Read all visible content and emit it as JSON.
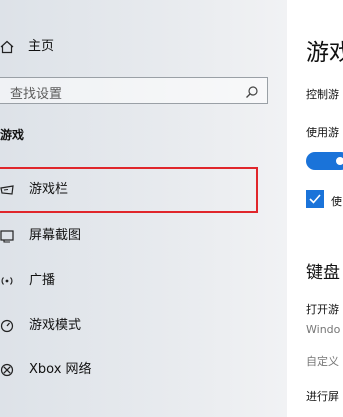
{
  "sidebar": {
    "home_label": "主页",
    "search_placeholder": "查找设置",
    "section_title": "游戏",
    "items": [
      {
        "label": "游戏栏",
        "icon": "game-bar-icon"
      },
      {
        "label": "屏幕截图",
        "icon": "capture-icon"
      },
      {
        "label": "广播",
        "icon": "broadcast-icon"
      },
      {
        "label": "游戏模式",
        "icon": "game-mode-icon"
      },
      {
        "label": "Xbox 网络",
        "icon": "xbox-icon"
      }
    ]
  },
  "content": {
    "title": "游戏",
    "description": "控制游",
    "toggle_label": "使用游",
    "checkbox_label": "使",
    "keyboard_heading": "键盘",
    "open_label": "打开游",
    "open_value": "Windo",
    "custom_label": "自定义",
    "record_label": "进行屏"
  },
  "colors": {
    "accent": "#1a73d9",
    "highlight_border": "#e0262b"
  }
}
